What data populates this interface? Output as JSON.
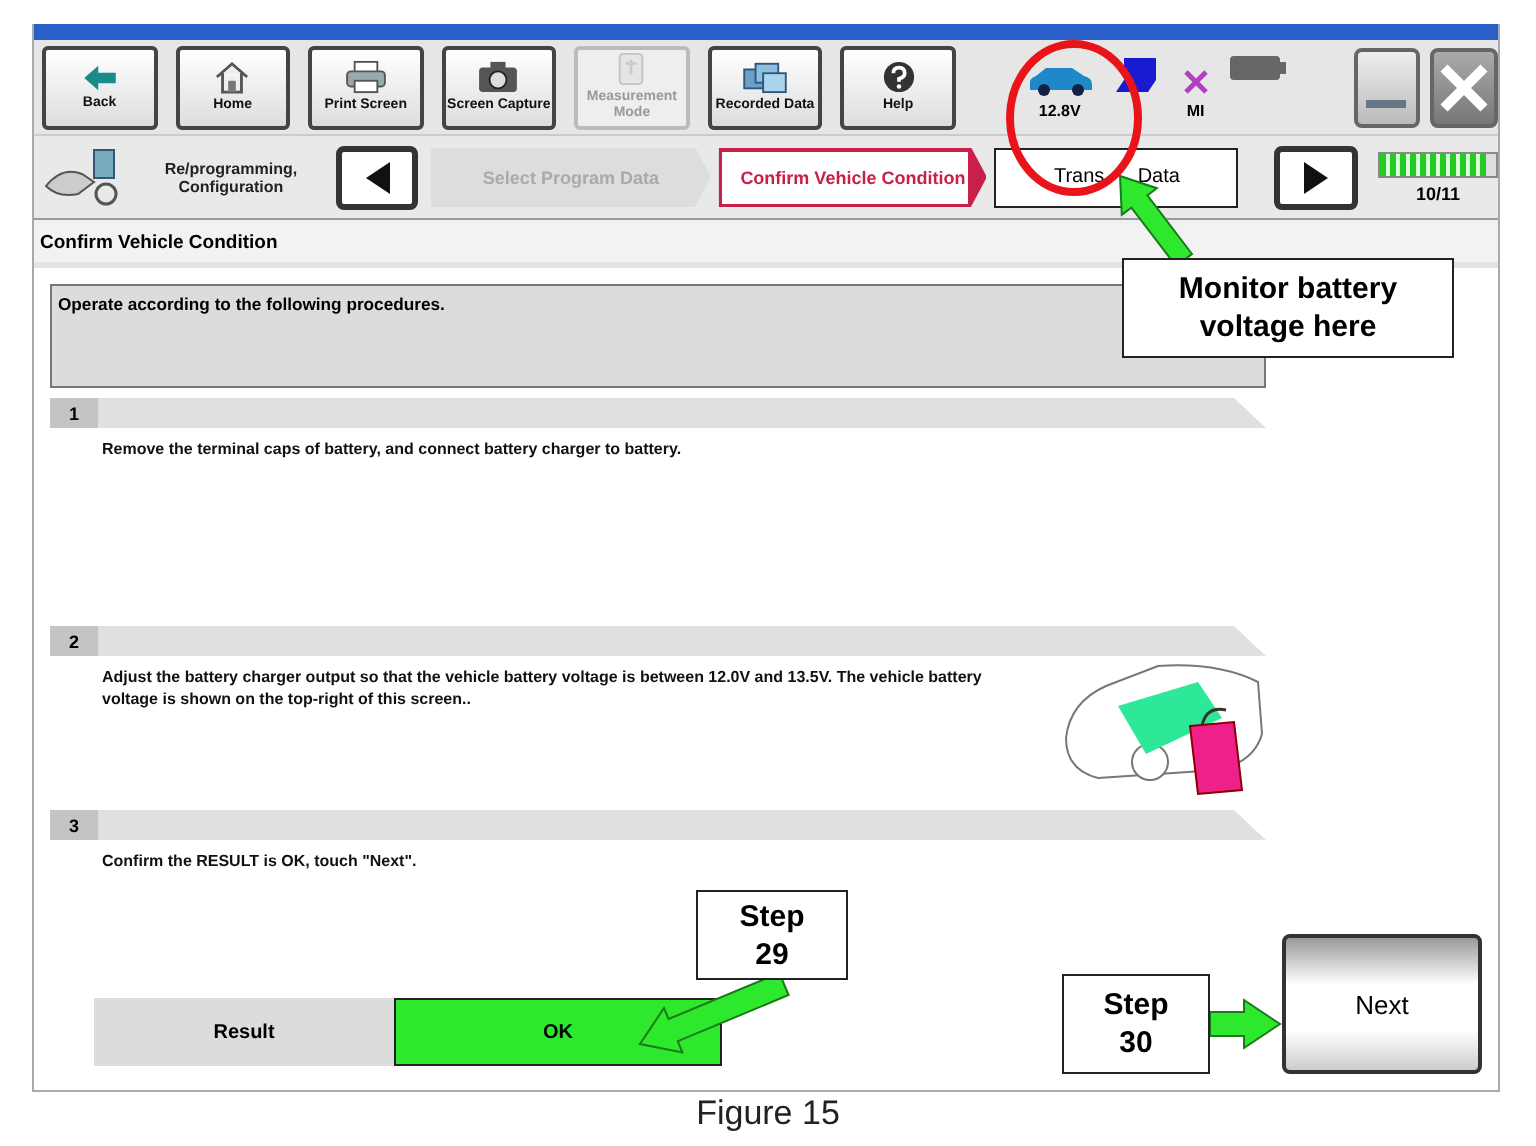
{
  "toolbar": {
    "buttons": [
      {
        "kind": "back",
        "label": "Back",
        "disabled": false
      },
      {
        "kind": "home",
        "label": "Home",
        "disabled": false
      },
      {
        "kind": "print",
        "label": "Print Screen",
        "disabled": false
      },
      {
        "kind": "camera",
        "label": "Screen Capture",
        "disabled": false
      },
      {
        "kind": "meter",
        "label": "Measurement Mode",
        "disabled": true
      },
      {
        "kind": "folders",
        "label": "Recorded Data",
        "disabled": false
      },
      {
        "kind": "help",
        "label": "Help",
        "disabled": false
      }
    ],
    "status": {
      "voltage": "12.8V",
      "mi_label": "MI"
    }
  },
  "navigation": {
    "mode": "Re/programming, Configuration",
    "steps": [
      {
        "label": "Select Program Data",
        "selected": false,
        "disabled": true
      },
      {
        "label": "Confirm Vehicle Condition",
        "selected": true,
        "disabled": false
      },
      {
        "label": "Trans      Data",
        "selected": false,
        "disabled": false
      }
    ],
    "progress": {
      "level": 0.91,
      "reading": "10/11"
    }
  },
  "page_title": "Confirm Vehicle Condition",
  "instruction": "Operate according to the following procedures.",
  "steps": [
    {
      "number": "1",
      "text": "Remove the terminal caps of battery, and connect battery charger to battery.",
      "illustration": false
    },
    {
      "number": "2",
      "text": "Adjust the battery charger output so that the vehicle battery voltage is between 12.0V and 13.5V. The vehicle battery voltage is shown on the top-right of this screen..",
      "illustration": true
    },
    {
      "number": "3",
      "text": "Confirm the RESULT is OK, touch \"Next\".",
      "illustration": false
    }
  ],
  "result": {
    "label": "Result",
    "value": "OK"
  },
  "next_button": "Next",
  "annotations": [
    {
      "text": "Monitor battery voltage here"
    },
    {
      "text": "Step 29"
    },
    {
      "text": "Step 30"
    }
  ],
  "caption": "Figure 15"
}
